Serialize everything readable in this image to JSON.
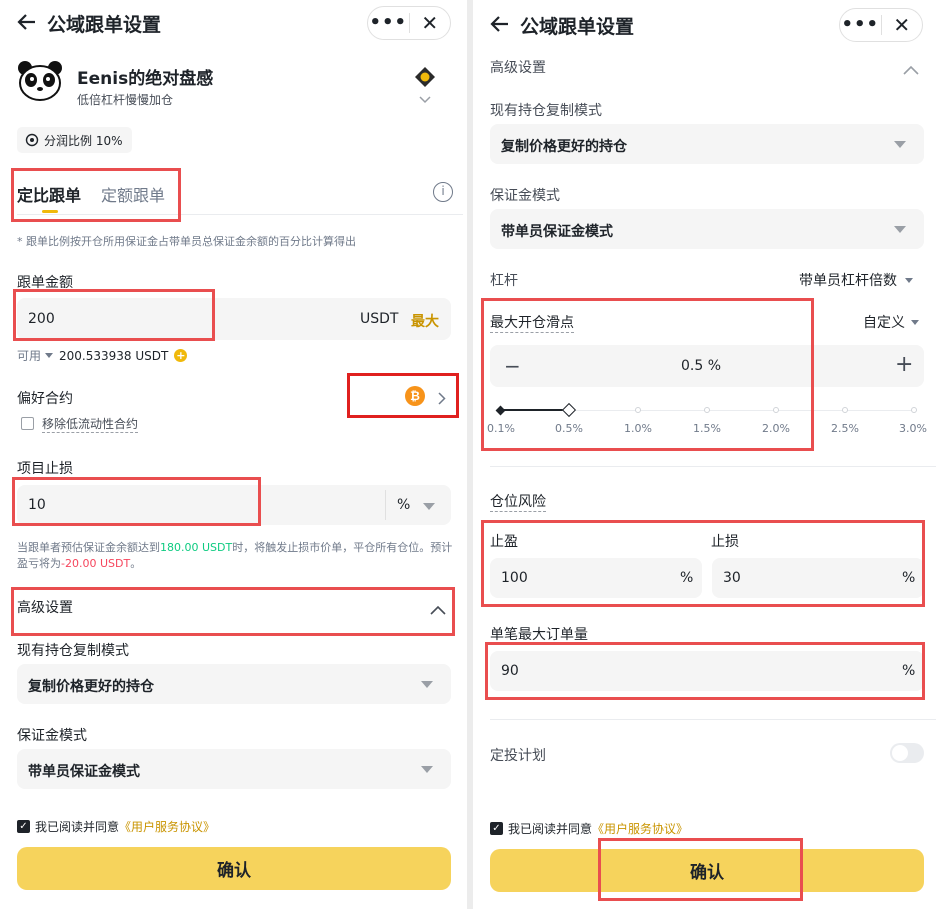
{
  "header": {
    "back_icon": "arrow-left-icon",
    "title": "公域跟单设置",
    "more_icon": "more-dots-icon",
    "close_icon": "close-icon"
  },
  "trader": {
    "name": "Eenis的绝对盘感",
    "desc": "低倍杠杆慢慢加仓",
    "profit_share": "分润比例 10%",
    "badge_icon": "trader-badge-icon",
    "expand_icon": "chevron-down-icon"
  },
  "tabs": {
    "ratio": "定比跟单",
    "fixed": "定额跟单",
    "active": "ratio"
  },
  "ratio_note": "* 跟单比例按开仓所用保证金占带单员总保证金余额的百分比计算得出",
  "amount": {
    "label": "跟单金额",
    "value": "200",
    "unit": "USDT",
    "max": "最大",
    "available_label": "可用",
    "available_value": "200.533938 USDT"
  },
  "preferred": {
    "label": "偏好合约",
    "coin_icon": "bitcoin-icon",
    "remove_low_liquidity": "移除低流动性合约",
    "remove_checked": false
  },
  "stop_loss": {
    "label": "项目止损",
    "value": "10",
    "unit": "%",
    "note_a": "当跟单者预估保证金余额达到",
    "note_threshold": "180.00 USDT",
    "note_b": "时，将触发止损市价单，平仓所有仓位。预计盈亏将为",
    "note_pnl": "-20.00 USDT",
    "note_c": "。"
  },
  "advanced": {
    "label": "高级设置",
    "expanded": true,
    "copy_mode_label": "现有持仓复制模式",
    "copy_mode_value": "复制价格更好的持仓",
    "margin_mode_label": "保证金模式",
    "margin_mode_value": "带单员保证金模式",
    "leverage_label": "杠杆",
    "leverage_value": "带单员杠杆倍数",
    "slippage_label": "最大开仓滑点",
    "slippage_mode": "自定义",
    "slippage_value": "0.5 %",
    "slippage_current": 0.5,
    "slippage_ticks": [
      "0.1%",
      "0.5%",
      "1.0%",
      "1.5%",
      "2.0%",
      "2.5%",
      "3.0%"
    ],
    "minus": "−",
    "plus": "+"
  },
  "risk": {
    "label": "仓位风险",
    "take_profit_label": "止盈",
    "take_profit_value": "100",
    "stop_loss_label": "止损",
    "stop_loss_value": "30",
    "unit": "%",
    "max_order_label": "单笔最大订单量",
    "max_order_value": "90",
    "dca_label": "定投计划",
    "dca_enabled": false
  },
  "agreement": {
    "prefix": "我已阅读并同意",
    "link": "《用户服务协议》",
    "checked": true
  },
  "confirm": "确认",
  "colors": {
    "accent": "#f6d35c",
    "gold": "#c99400",
    "green": "#0ecb81",
    "red": "#f6465d",
    "highlight": "#e94e4f"
  }
}
